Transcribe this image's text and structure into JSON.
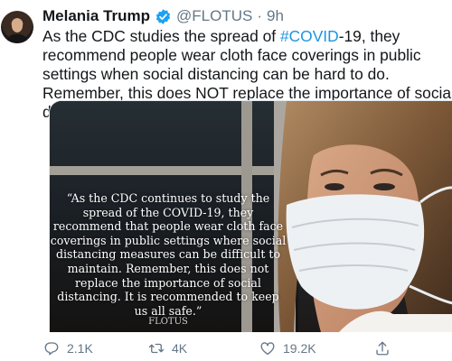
{
  "tweet": {
    "author_name": "Melania Trump",
    "handle": "@FLOTUS",
    "separator": "·",
    "time": "9h",
    "text_before": "As the CDC studies the spread of ",
    "hashtag": "#COVID",
    "text_after": "-19, they recommend people wear cloth face coverings in public settings when social distancing can be hard to do. Remember, this does NOT replace the importance of social distancing."
  },
  "media": {
    "quote_text": "“As the CDC continues to study the spread of the COVID-19, they recommend that people wear cloth face coverings in public settings where social distancing measures can be difficult to maintain. Remember, this does not replace the importance of social distancing. It is recommended to keep us all safe.”",
    "signature": "FLOTUS"
  },
  "actions": {
    "reply_count": "2.1K",
    "retweet_count": "4K",
    "like_count": "19.2K"
  },
  "icons": {
    "verified": "verified-badge-icon",
    "reply": "reply-icon",
    "retweet": "retweet-icon",
    "like": "heart-icon",
    "share": "share-icon"
  },
  "colors": {
    "link": "#1b95e0",
    "secondary_text": "#657786",
    "verified": "#1da1f2"
  }
}
